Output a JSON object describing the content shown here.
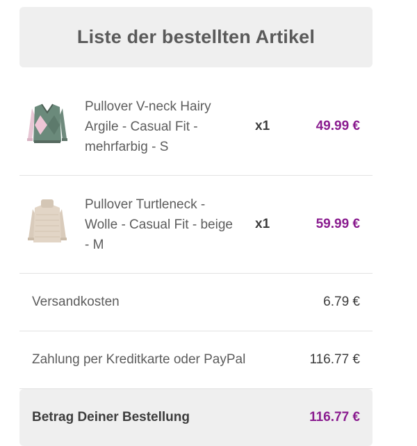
{
  "header": {
    "title": "Liste der bestellten Artikel"
  },
  "items": [
    {
      "name": "Pullover V-neck Hairy Argile - Casual Fit - mehrfarbig - S",
      "quantity": "x1",
      "price": "49.99 €",
      "image_icon": "green-pink-argyle-sweater-image"
    },
    {
      "name": "Pullover Turtleneck - Wolle - Casual Fit - beige - M",
      "quantity": "x1",
      "price": "59.99 €",
      "image_icon": "beige-turtleneck-sweater-image"
    }
  ],
  "shipping": {
    "label": "Versandkosten",
    "value": "6.79 €"
  },
  "payment": {
    "label": "Zahlung per Kreditkarte oder PayPal",
    "value": "116.77 €"
  },
  "total": {
    "label": "Betrag Deiner Bestellung",
    "value": "116.77 €"
  },
  "colors": {
    "accent_price": "#8a1c8f",
    "panel_bg": "#efefef",
    "divider": "#e2e2e2"
  }
}
